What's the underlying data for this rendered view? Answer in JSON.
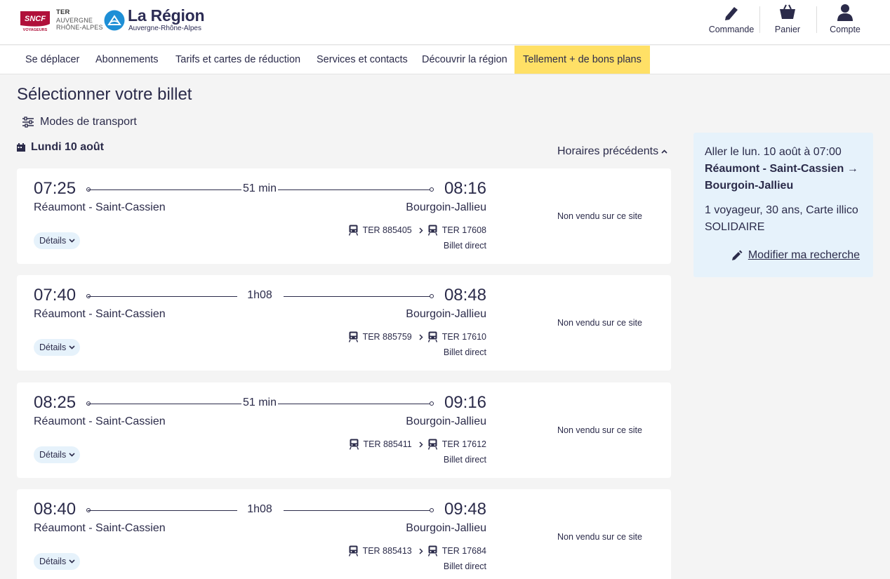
{
  "header": {
    "sncf_line1": "SNCF",
    "sncf_line2": "VOYAGEURS",
    "ter_line1": "TER",
    "ter_line2": "AUVERGNE",
    "ter_line3": "RHÔNE-ALPES",
    "region_name": "La Région",
    "region_sub": "Auvergne-Rhône-Alpes",
    "actions": {
      "order": "Commande",
      "cart": "Panier",
      "account": "Compte"
    }
  },
  "nav": {
    "items": [
      "Se déplacer",
      "Abonnements",
      "Tarifs et cartes de réduction",
      "Services et contacts",
      "Découvrir la région",
      "Tellement + de bons plans"
    ]
  },
  "page": {
    "title": "Sélectionner votre billet",
    "modes": "Modes de transport",
    "date": "Lundi 10 août",
    "previous": "Horaires précédents"
  },
  "results": [
    {
      "dep_time": "07:25",
      "arr_time": "08:16",
      "duration": "51 min",
      "dep_station": "Réaumont - Saint-Cassien",
      "arr_station": "Bourgoin-Jallieu",
      "train1": "TER 885405",
      "train2": "TER 17608",
      "ticket": "Billet direct",
      "details": "Détails",
      "status": "Non vendu sur ce site"
    },
    {
      "dep_time": "07:40",
      "arr_time": "08:48",
      "duration": "1h08",
      "dep_station": "Réaumont - Saint-Cassien",
      "arr_station": "Bourgoin-Jallieu",
      "train1": "TER 885759",
      "train2": "TER 17610",
      "ticket": "Billet direct",
      "details": "Détails",
      "status": "Non vendu sur ce site"
    },
    {
      "dep_time": "08:25",
      "arr_time": "09:16",
      "duration": "51 min",
      "dep_station": "Réaumont - Saint-Cassien",
      "arr_station": "Bourgoin-Jallieu",
      "train1": "TER 885411",
      "train2": "TER 17612",
      "ticket": "Billet direct",
      "details": "Détails",
      "status": "Non vendu sur ce site"
    },
    {
      "dep_time": "08:40",
      "arr_time": "09:48",
      "duration": "1h08",
      "dep_station": "Réaumont - Saint-Cassien",
      "arr_station": "Bourgoin-Jallieu",
      "train1": "TER 885413",
      "train2": "TER 17684",
      "ticket": "Billet direct",
      "details": "Détails",
      "status": "Non vendu sur ce site"
    }
  ],
  "summary": {
    "outbound": "Aller le lun. 10 août à 07:00",
    "route": "Réaumont - Saint-Cassien → Bourgoin-Jallieu",
    "travellers": "1 voyageur, 30 ans, Carte illico SOLIDAIRE",
    "modify": "Modifier ma recherche"
  },
  "colors": {
    "primary_text": "#2b2b4a",
    "highlight_nav": "#ffe066",
    "summary_bg": "#e6f2fb",
    "sncf_red": "#b0103a",
    "region_blue": "#1e8fd6"
  }
}
